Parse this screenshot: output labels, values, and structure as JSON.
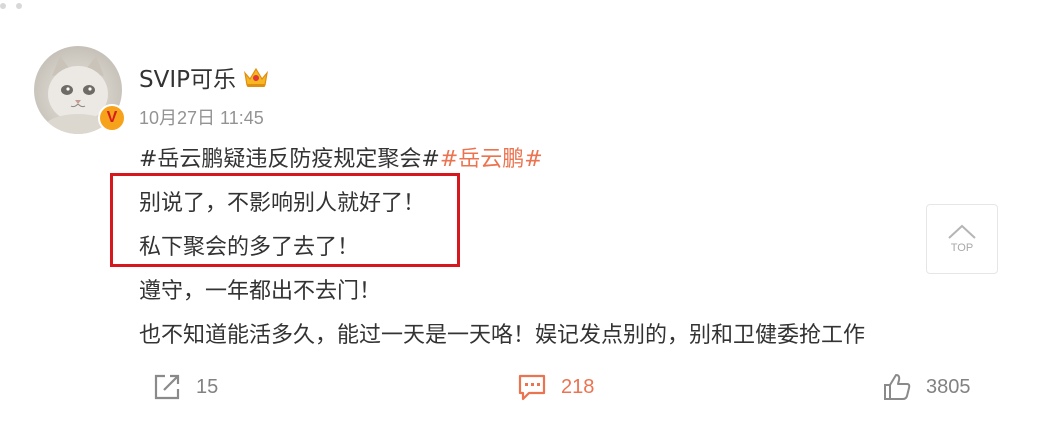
{
  "post": {
    "username": "SVIP可乐",
    "timestamp": "10月27日 11:45",
    "verified_badge": "V",
    "hashtags": [
      "#岳云鹏疑违反防疫规定聚会#",
      "#岳云鹏#"
    ],
    "lines": [
      "别说了，不影响别人就好了！",
      "私下聚会的多了去了！",
      "遵守，一年都出不去门！",
      "也不知道能活多久，能过一天是一天咯！娱记发点别的，别和卫健委抢工作"
    ]
  },
  "top_button": {
    "label": "TOP"
  },
  "actions": {
    "repost_count": "15",
    "comment_count": "218",
    "like_count": "3805"
  },
  "colors": {
    "hashtag_accent": "#eb7350",
    "highlight_border": "#d7171e",
    "text": "#333333",
    "meta": "#939393"
  },
  "icons": [
    "crown-icon",
    "verified-v-icon",
    "chevron-up-icon",
    "repost-icon",
    "comment-icon",
    "like-icon"
  ]
}
